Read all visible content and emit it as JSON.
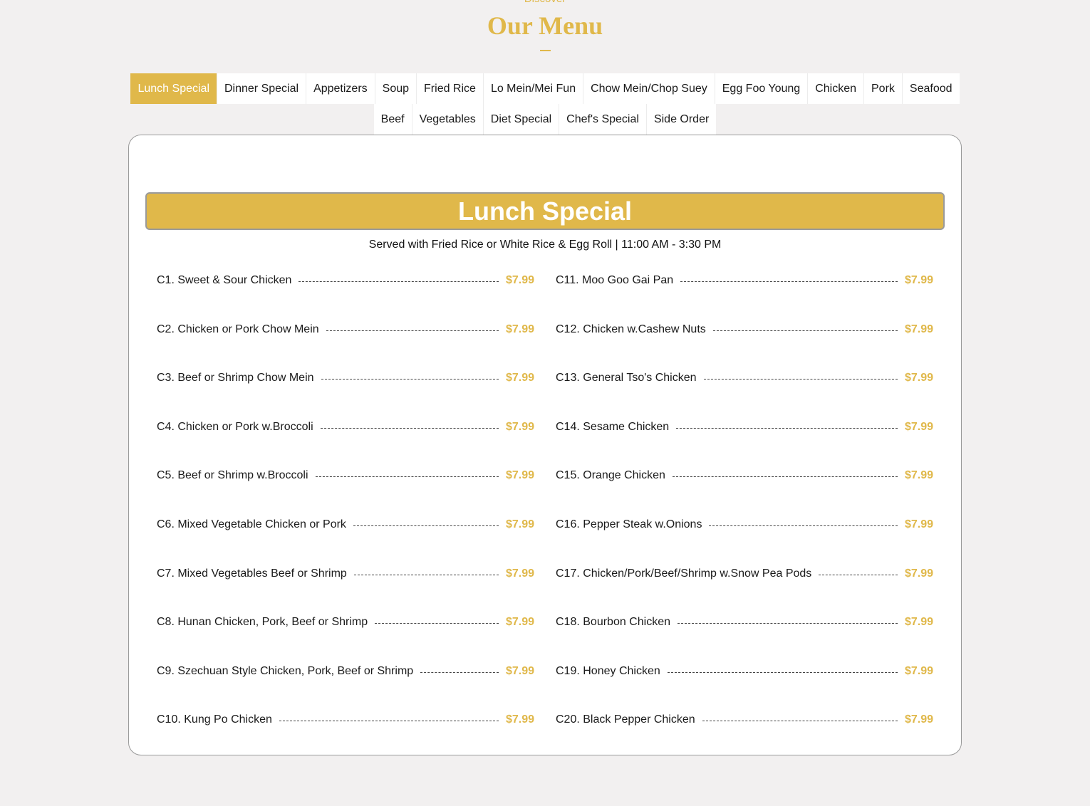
{
  "header": {
    "eyebrow": "Discover",
    "title": "Our Menu"
  },
  "tabs_row1": [
    {
      "label": "Lunch Special",
      "active": true
    },
    {
      "label": "Dinner Special"
    },
    {
      "label": "Appetizers"
    },
    {
      "label": "Soup"
    },
    {
      "label": "Fried Rice"
    },
    {
      "label": "Lo Mein/Mei Fun"
    },
    {
      "label": "Chow Mein/Chop Suey"
    },
    {
      "label": "Egg Foo Young"
    },
    {
      "label": "Chicken"
    },
    {
      "label": "Pork"
    },
    {
      "label": "Seafood"
    }
  ],
  "tabs_row2": [
    {
      "label": "Beef"
    },
    {
      "label": "Vegetables"
    },
    {
      "label": "Diet Special"
    },
    {
      "label": "Chef's Special"
    },
    {
      "label": "Side Order"
    }
  ],
  "section": {
    "title": "Lunch Special",
    "subtitle": "Served with Fried Rice or White Rice & Egg Roll | 11:00 AM - 3:30 PM"
  },
  "items_left": [
    {
      "name": "C1. Sweet & Sour Chicken",
      "price": "$7.99"
    },
    {
      "name": "C2. Chicken or Pork Chow Mein",
      "price": "$7.99"
    },
    {
      "name": "C3. Beef or Shrimp Chow Mein",
      "price": "$7.99"
    },
    {
      "name": "C4. Chicken or Pork w.Broccoli",
      "price": "$7.99"
    },
    {
      "name": "C5. Beef or Shrimp w.Broccoli",
      "price": "$7.99"
    },
    {
      "name": "C6. Mixed Vegetable Chicken or Pork",
      "price": "$7.99"
    },
    {
      "name": "C7. Mixed Vegetables Beef or Shrimp",
      "price": "$7.99"
    },
    {
      "name": "C8. Hunan Chicken, Pork, Beef or Shrimp",
      "price": "$7.99"
    },
    {
      "name": "C9. Szechuan Style Chicken, Pork, Beef or Shrimp",
      "price": "$7.99"
    },
    {
      "name": "C10. Kung Po Chicken",
      "price": "$7.99"
    }
  ],
  "items_right": [
    {
      "name": "C11. Moo Goo Gai Pan",
      "price": "$7.99"
    },
    {
      "name": "C12. Chicken w.Cashew Nuts",
      "price": "$7.99"
    },
    {
      "name": "C13. General Tso's Chicken",
      "price": "$7.99"
    },
    {
      "name": "C14. Sesame Chicken",
      "price": "$7.99"
    },
    {
      "name": "C15. Orange Chicken",
      "price": "$7.99"
    },
    {
      "name": "C16. Pepper Steak w.Onions",
      "price": "$7.99"
    },
    {
      "name": "C17. Chicken/Pork/Beef/Shrimp w.Snow Pea Pods",
      "price": "$7.99"
    },
    {
      "name": "C18. Bourbon Chicken",
      "price": "$7.99"
    },
    {
      "name": "C19. Honey Chicken",
      "price": "$7.99"
    },
    {
      "name": "C20. Black Pepper Chicken",
      "price": "$7.99"
    }
  ],
  "colors": {
    "accent": "#e0b84a",
    "background": "#f2f0f0"
  }
}
